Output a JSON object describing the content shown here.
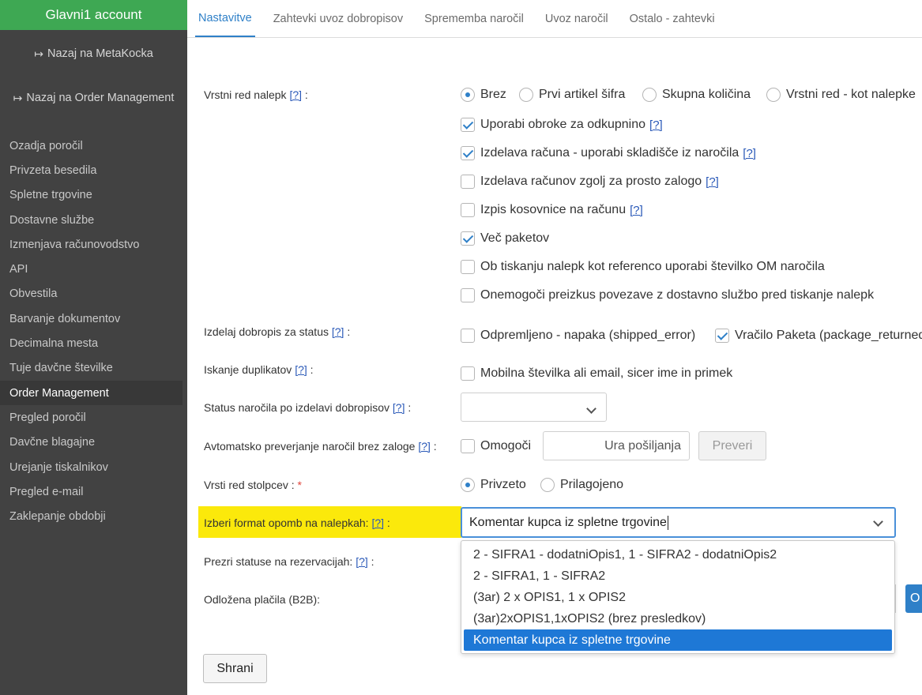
{
  "sidebar": {
    "account": "Glavni1 account",
    "back_metakocka": "Nazaj na MetaKocka",
    "back_order_management": "Nazaj na Order Management",
    "items": [
      "Ozadja poročil",
      "Privzeta besedila",
      "Spletne trgovine",
      "Dostavne službe",
      "Izmenjava računovodstvo",
      "API",
      "Obvestila",
      "Barvanje dokumentov",
      "Decimalna mesta",
      "Tuje davčne številke",
      "Order Management",
      "Pregled poročil",
      "Davčne blagajne",
      "Urejanje tiskalnikov",
      "Pregled e-mail",
      "Zaklepanje obdobji"
    ],
    "active_item": "Order Management"
  },
  "tabs": [
    "Nastavitve",
    "Zahtevki uvoz dobropisov",
    "Sprememba naročil",
    "Uvoz naročil",
    "Ostalo - zahtevki"
  ],
  "help": "[?]",
  "labels": {
    "vrstni_red_nalepk": "Vrstni red nalepk",
    "izdelaj_dobropis": "Izdelaj dobropis za status",
    "iskanje_duplikatov": "Iskanje duplikatov",
    "status_narocila": "Status naročila po izdelavi dobropisov",
    "avtomatsko_preverjanje": "Avtomatsko preverjanje naročil brez zaloge",
    "vrsti_red_stolpcev": "Vrsti red stolpcev :",
    "izberi_format": "Izberi format opomb na nalepkah:",
    "prezri_statuse": "Prezri statuse na rezervacijah:",
    "odlozena_placila": "Odložena plačila (B2B):"
  },
  "label_order_radios": [
    "Brez",
    "Prvi artikel šifra",
    "Skupna količina",
    "Vrstni red - kot nalepke"
  ],
  "checkboxes": {
    "uporabi_obroke": "Uporabi obroke za odkupnino",
    "izdelava_racuna_skladisce": "Izdelava računa - uporabi skladišče iz naročila",
    "izdelava_racunov_zaloga": "Izdelava računov zgolj za prosto zalogo",
    "izpis_kosovnice": "Izpis kosovnice na računu",
    "vec_paketov": "Več paketov",
    "ob_tiskanju": "Ob tiskanju nalepk kot referenco uporabi številko OM naročila",
    "onemogoci_preizkus": "Onemogoči preizkus povezave z dostavno službo pred tiskanje nalepk",
    "odpremljeno": "Odpremljeno - napaka (shipped_error)",
    "vracilo": "Vračilo Paketa (package_returned)",
    "mobilna": "Mobilna številka ali email, sicer ime in primek",
    "omogoci": "Omogoči"
  },
  "ura_posiljanja_placeholder": "Ura pošiljanja",
  "preveri_button": "Preveri",
  "column_order_radios": [
    "Privzeto",
    "Prilagojeno"
  ],
  "format_select_value": "Komentar kupca iz spletne trgovine",
  "format_options": [
    "2 - SIFRA1 - dodatniOpis1, 1 - SIFRA2 - dodatniOpis2",
    "2 - SIFRA1, 1 - SIFRA2",
    "(3ar) 2 x OPIS1, 1 x OPIS2",
    "(3ar)2xOPIS1,1xOPIS2 (brez presledkov)",
    "Komentar kupca iz spletne trgovine"
  ],
  "edge_button_label": "O",
  "save_button": "Shrani"
}
